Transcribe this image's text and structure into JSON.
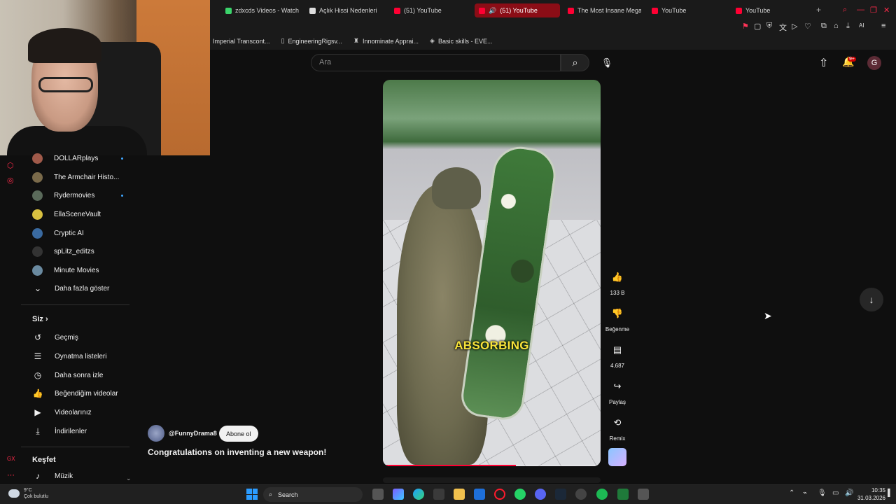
{
  "browser": {
    "tabs": [
      {
        "label": "zdxcds Videos - Watch",
        "fav": "green"
      },
      {
        "label": "Açlık Hissi Nedenleri",
        "fav": "grey"
      },
      {
        "label": "(51) YouTube",
        "fav": "yt"
      },
      {
        "label": "(51) YouTube",
        "fav": "yt",
        "active": true
      },
      {
        "label": "The Most Insane Mega",
        "fav": "yt"
      },
      {
        "label": "YouTube",
        "fav": "yt"
      },
      {
        "label": "YouTube",
        "fav": "yt"
      }
    ],
    "bookmarks": [
      {
        "label": "Imperial Transcont..."
      },
      {
        "label": "EngineeringRigsv..."
      },
      {
        "label": "Innominate Apprai..."
      },
      {
        "label": "Basic skills - EVE..."
      }
    ],
    "ai_label": "AI"
  },
  "header": {
    "search_placeholder": "Ara",
    "notification_count": "9+",
    "avatar_letter": "G"
  },
  "sidebar": {
    "subscriptions": [
      {
        "label": "DOLLARplays",
        "dot": true,
        "color": "#a05a4a"
      },
      {
        "label": "The Armchair Histo...",
        "dot": false,
        "color": "#7a6a4a"
      },
      {
        "label": "Rydermovies",
        "dot": true,
        "color": "#5a6a5a"
      },
      {
        "label": "EllaSceneVault",
        "dot": false,
        "color": "#d8c040"
      },
      {
        "label": "Cryptic AI",
        "dot": false,
        "color": "#3a6aa0"
      },
      {
        "label": "spLitz_editzs",
        "dot": false,
        "color": "#333333"
      },
      {
        "label": "Minute Movies",
        "dot": false,
        "color": "#6a8aa0"
      }
    ],
    "show_more": "Daha fazla göster",
    "you_section": "Siz",
    "you_items": [
      {
        "label": "Geçmiş",
        "icon": "history-icon"
      },
      {
        "label": "Oynatma listeleri",
        "icon": "playlist-icon"
      },
      {
        "label": "Daha sonra izle",
        "icon": "watch-later-icon"
      },
      {
        "label": "Beğendiğim videolar",
        "icon": "thumbs-up-icon"
      },
      {
        "label": "Videolarınız",
        "icon": "your-videos-icon"
      },
      {
        "label": "İndirilenler",
        "icon": "download-icon"
      }
    ],
    "explore_section": "Keşfet",
    "explore_items": [
      {
        "label": "Müzik",
        "icon": "music-icon"
      }
    ]
  },
  "video": {
    "caption": "ABSORBING",
    "progress": 0.61
  },
  "actions": {
    "like_count": "133 B",
    "dislike_label": "Beğenme",
    "comment_count": "4.687",
    "share_label": "Paylaş",
    "remix_label": "Remix"
  },
  "channel": {
    "name": "@FunnyDrama8",
    "subscribe_label": "Abone ol"
  },
  "title": "Congratulations on inventing a new weapon!",
  "taskbar": {
    "weather_temp": "9°C",
    "weather_desc": "Çok bulutlu",
    "search_label": "Search",
    "time": "10:35",
    "date": "31.03.2026"
  }
}
